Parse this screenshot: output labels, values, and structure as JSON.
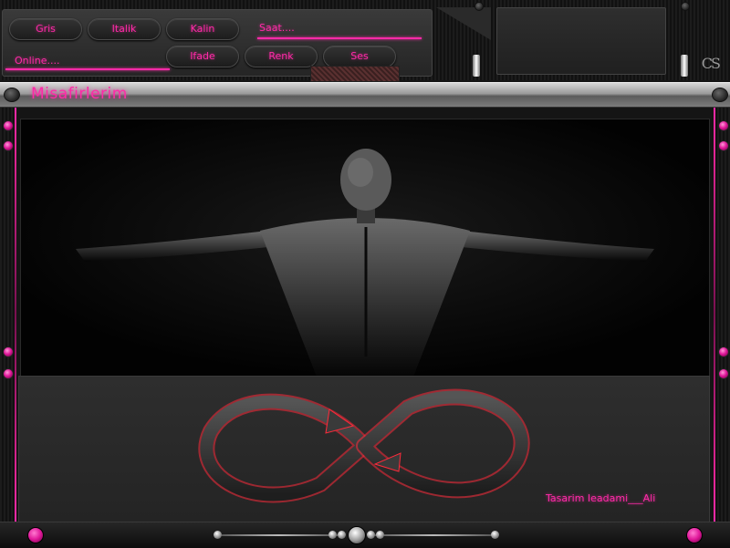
{
  "toolbar": {
    "buttons_row1": [
      {
        "label": "Gris",
        "name": "gris-button"
      },
      {
        "label": "Italik",
        "name": "italik-button"
      },
      {
        "label": "Kalin",
        "name": "kalin-button"
      }
    ],
    "buttons_row2": [
      {
        "label": "Ifade",
        "name": "ifade-button"
      },
      {
        "label": "Renk",
        "name": "renk-button"
      },
      {
        "label": "Ses",
        "name": "ses-button"
      }
    ],
    "clock_text": "Saat....",
    "online_text": "Online...."
  },
  "brand": {
    "logo_text": "CS"
  },
  "window": {
    "title": "Misafirlerim"
  },
  "content": {
    "photo_description_icon": "man-back-arms-outstretched-image",
    "emblem_icon": "infinity-arrows-icon",
    "credit_text": "Tasarim Ieadami___Ali"
  },
  "bottombar": {
    "left_icon": "pink-dot-icon",
    "right_icon": "pink-dot-icon"
  },
  "colors": {
    "accent": "#ff2aa8",
    "background": "#151515",
    "panel": "#2a2a2a"
  }
}
